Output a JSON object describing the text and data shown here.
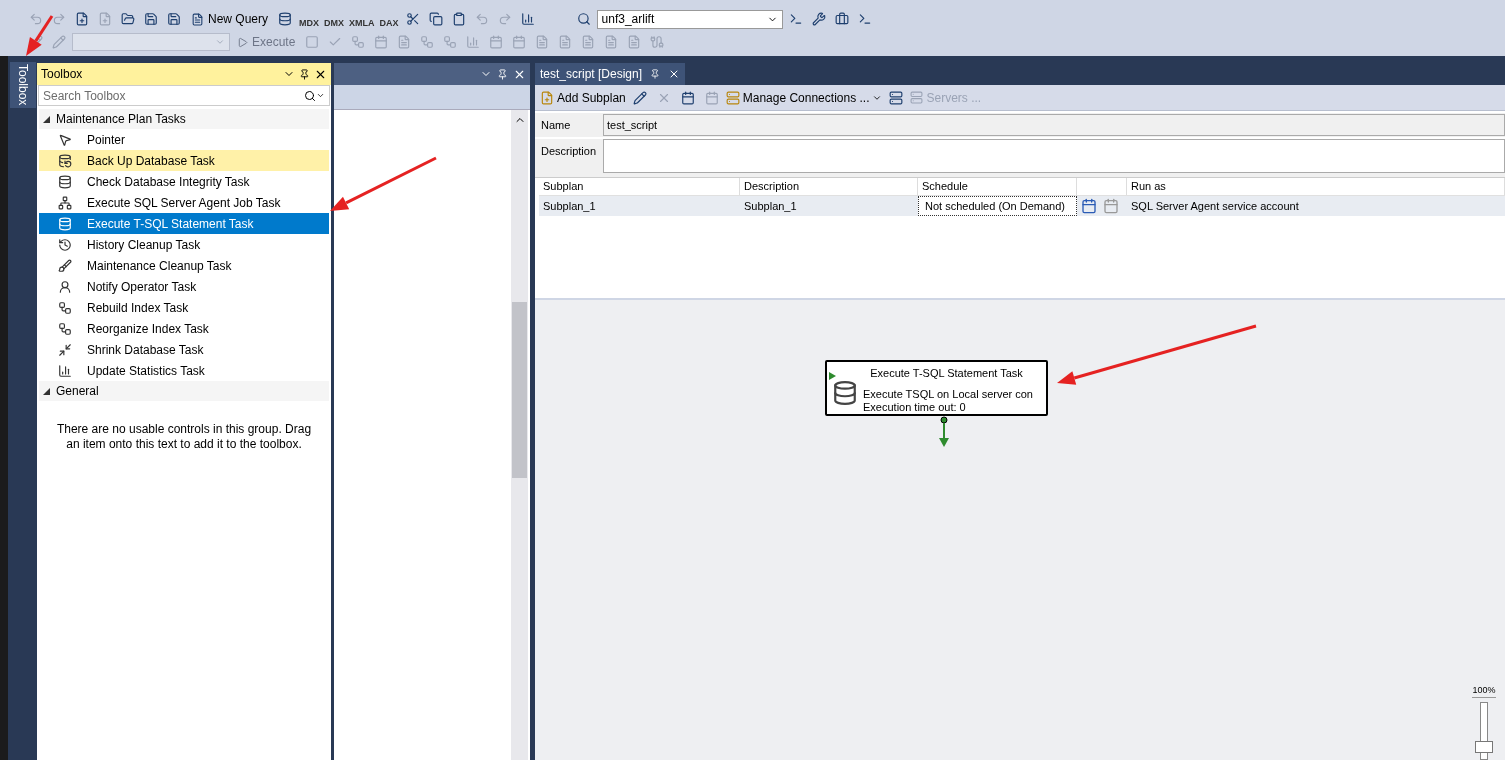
{
  "toolbar": {
    "new_query": "New Query",
    "script_labels": [
      "MDX",
      "DMX",
      "XMLA",
      "DAX"
    ],
    "database": "unf3_arlift",
    "execute": "Execute"
  },
  "side_tab": {
    "label": "Toolbox",
    "selected": true
  },
  "toolbox": {
    "title": "Toolbox",
    "search_placeholder": "Search Toolbox",
    "groups": [
      {
        "label": "Maintenance Plan Tasks",
        "expanded": true,
        "items": [
          {
            "label": "Pointer",
            "selected": false,
            "highlighted": false
          },
          {
            "label": "Back Up Database Task",
            "selected": false,
            "highlighted": true
          },
          {
            "label": "Check Database Integrity Task",
            "selected": false,
            "highlighted": false
          },
          {
            "label": "Execute SQL Server Agent Job Task",
            "selected": false,
            "highlighted": false
          },
          {
            "label": "Execute T-SQL Statement Task",
            "selected": true,
            "highlighted": false
          },
          {
            "label": "History Cleanup Task",
            "selected": false,
            "highlighted": false
          },
          {
            "label": "Maintenance Cleanup Task",
            "selected": false,
            "highlighted": false
          },
          {
            "label": "Notify Operator Task",
            "selected": false,
            "highlighted": false
          },
          {
            "label": "Rebuild Index Task",
            "selected": false,
            "highlighted": false
          },
          {
            "label": "Reorganize Index Task",
            "selected": false,
            "highlighted": false
          },
          {
            "label": "Shrink Database Task",
            "selected": false,
            "highlighted": false
          },
          {
            "label": "Update Statistics Task",
            "selected": false,
            "highlighted": false
          }
        ]
      },
      {
        "label": "General",
        "expanded": true,
        "empty_text": "There are no usable controls in this group. Drag an item onto this text to add it to the toolbox."
      }
    ]
  },
  "designer": {
    "tab": "test_script [Design]",
    "toolbar": [
      {
        "label": "Add Subplan",
        "disabled": false
      },
      {
        "label": "Manage Connections ...",
        "disabled": false
      },
      {
        "label": "Servers ...",
        "disabled": true
      }
    ],
    "name_label": "Name",
    "name_value": "test_script",
    "description_label": "Description",
    "subplans": {
      "columns": [
        "Subplan",
        "Description",
        "Schedule",
        "Run as"
      ],
      "rows": [
        {
          "subplan": "Subplan_1",
          "description": "Subplan_1",
          "schedule": "Not scheduled (On Demand)",
          "run_as": "SQL Server Agent service account"
        }
      ]
    },
    "task": {
      "title": "Execute T-SQL Statement Task",
      "lines": [
        "Execute TSQL on Local server con",
        "Execution time out: 0"
      ]
    },
    "zoom": {
      "label": "100%",
      "level": 0.15
    }
  }
}
